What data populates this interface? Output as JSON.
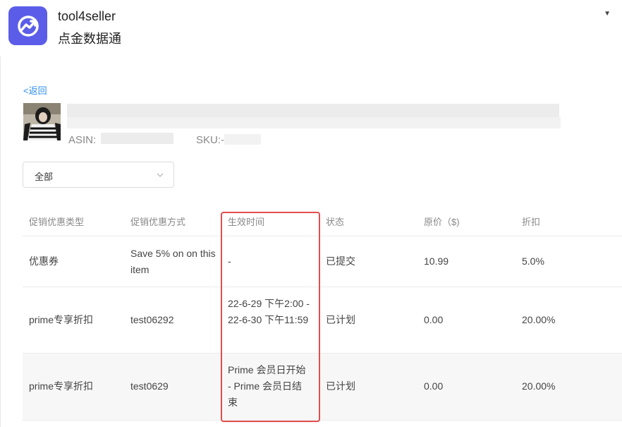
{
  "header": {
    "app_name": "tool4seller",
    "app_subtitle": "点金数据通",
    "menu_caret": "▼"
  },
  "back_link": "<返回",
  "product": {
    "asin_label": "ASIN:",
    "sku_label": "SKU:-"
  },
  "filter": {
    "selected": "全部"
  },
  "table": {
    "columns": [
      "促销优惠类型",
      "促销优惠方式",
      "生效时间",
      "状态",
      "原价（$)",
      "折扣"
    ],
    "rows": [
      {
        "type": "优惠券",
        "way": "Save 5% on on this item",
        "time": "-",
        "status": "已提交",
        "price": "10.99",
        "discount": "5.0%"
      },
      {
        "type": "prime专享折扣",
        "way": "test06292",
        "time": "22-6-29 下午2:00 - 22-6-30 下午11:59",
        "status": "已计划",
        "price": "0.00",
        "discount": "20.00%"
      },
      {
        "type": "prime专享折扣",
        "way": "test0629",
        "time": "Prime 会员日开始 - Prime 会员日结束",
        "status": "已计划",
        "price": "0.00",
        "discount": "20.00%"
      }
    ]
  },
  "colors": {
    "logo_bg": "#5b5de8",
    "link": "#2d8cf0",
    "highlight_border": "#e44d4d"
  }
}
